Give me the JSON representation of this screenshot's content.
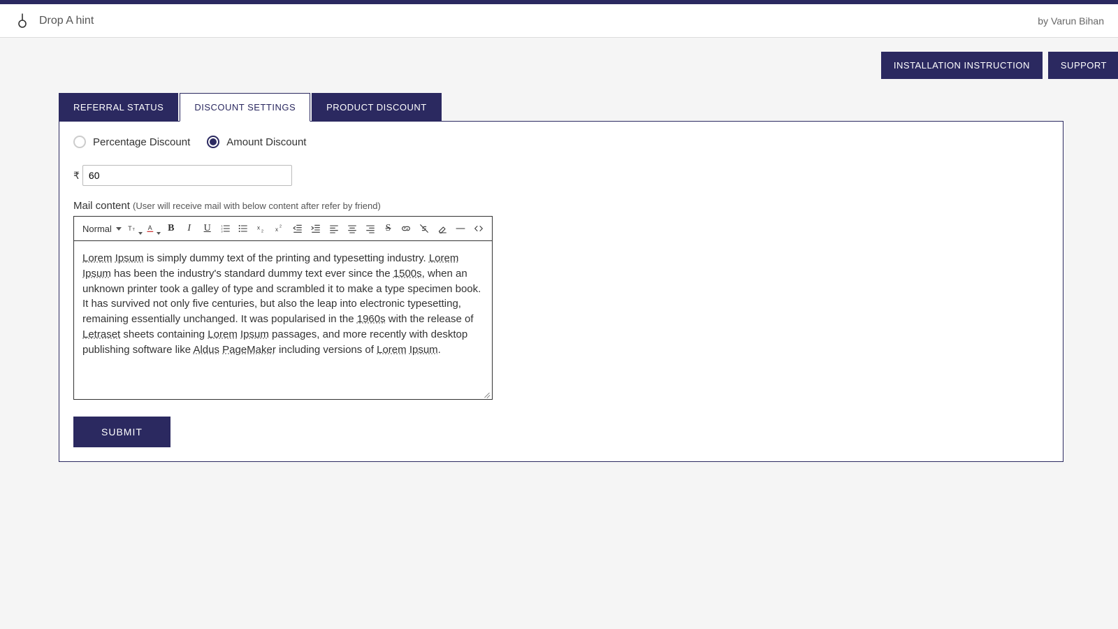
{
  "header": {
    "app_title": "Drop A hint",
    "author": "by Varun Bihan"
  },
  "top_buttons": {
    "install_label": "INSTALLATION INSTRUCTION",
    "support_label": "SUPPORT"
  },
  "tabs": {
    "referral": "REFERRAL STATUS",
    "discount": "DISCOUNT SETTINGS",
    "product": "PRODUCT DISCOUNT",
    "active": "discount"
  },
  "discount_type": {
    "percentage_label": "Percentage Discount",
    "amount_label": "Amount Discount",
    "selected": "amount"
  },
  "amount": {
    "currency": "₹",
    "value": "60"
  },
  "mail": {
    "label": "Mail content",
    "sublabel": "(User will receive mail with below content after refer by friend)"
  },
  "toolbar": {
    "format_label": "Normal"
  },
  "editor_text": "Lorem Ipsum is simply dummy text of the printing and typesetting industry. Lorem Ipsum has been the industry's standard dummy text ever since the 1500s, when an unknown printer took a galley of type and scrambled it to make a type specimen book. It has survived not only five centuries, but also the leap into electronic typesetting, remaining essentially unchanged. It was popularised in the 1960s with the release of Letraset sheets containing Lorem Ipsum passages, and more recently with desktop publishing software like Aldus PageMaker including versions of Lorem Ipsum.",
  "submit_label": "SUBMIT"
}
